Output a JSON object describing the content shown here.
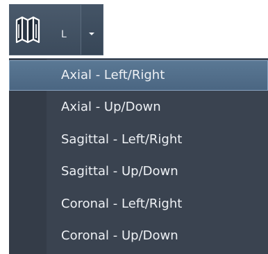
{
  "toolbar": {
    "orientation_button": {
      "icon": "book-icon",
      "letter": "L",
      "dropdown_icon": "chevron-down-icon"
    }
  },
  "menu": {
    "items": [
      {
        "label": "Axial - Left/Right",
        "selected": true
      },
      {
        "label": "Axial - Up/Down",
        "selected": false
      },
      {
        "label": "Sagittal - Left/Right",
        "selected": false
      },
      {
        "label": "Sagittal - Up/Down",
        "selected": false
      },
      {
        "label": "Coronal - Left/Right",
        "selected": false
      },
      {
        "label": "Coronal - Up/Down",
        "selected": false
      }
    ]
  },
  "colors": {
    "menu_background": "#3a4350",
    "selection": "#5a7894",
    "text": "#eef1f5"
  }
}
